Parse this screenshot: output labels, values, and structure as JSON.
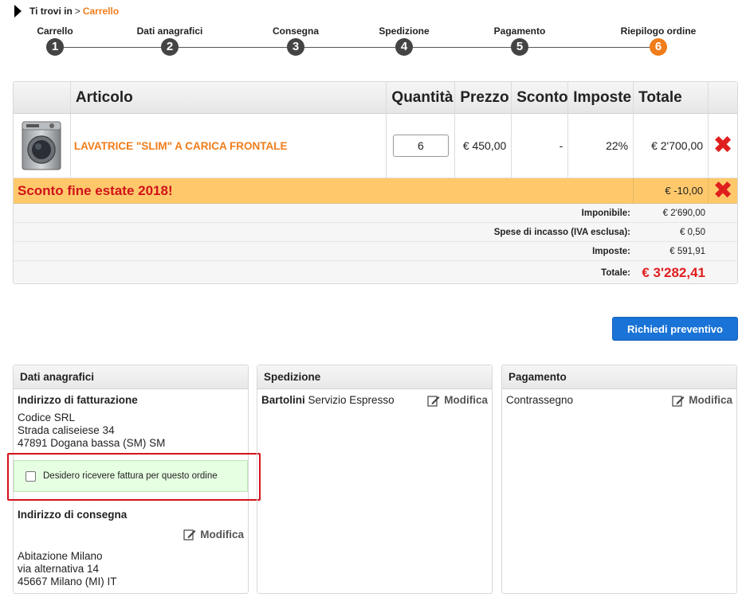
{
  "breadcrumb": {
    "prefix": "Ti trovi in",
    "separator": ">",
    "current": "Carrello"
  },
  "steps": [
    {
      "num": "1",
      "label": "Carrello"
    },
    {
      "num": "2",
      "label": "Dati anagrafici"
    },
    {
      "num": "3",
      "label": "Consegna"
    },
    {
      "num": "4",
      "label": "Spedizione"
    },
    {
      "num": "5",
      "label": "Pagamento"
    },
    {
      "num": "6",
      "label": "Riepilogo ordine"
    }
  ],
  "active_step": "6",
  "cart": {
    "headers": {
      "article": "Articolo",
      "qty": "Quantità",
      "price": "Prezzo",
      "discount": "Sconto",
      "tax": "Imposte",
      "total": "Totale"
    },
    "item": {
      "name": "LAVATRICE \"SLIM\" A CARICA FRONTALE",
      "qty": "6",
      "price": "€ 450,00",
      "discount": "-",
      "tax": "22%",
      "total": "€ 2'700,00"
    },
    "discount_row": {
      "name": "Sconto fine estate 2018!",
      "amount": "€ -10,00"
    },
    "summary": [
      {
        "label": "Imponibile:",
        "value": "€ 2'690,00"
      },
      {
        "label": "Spese di incasso (IVA esclusa):",
        "value": "€ 0,50"
      },
      {
        "label": "Imposte:",
        "value": "€ 591,91"
      }
    ],
    "total": {
      "label": "Totale:",
      "value": "€ 3'282,41"
    }
  },
  "quote_button": "Richiedi preventivo",
  "panels": {
    "personal": {
      "title": "Dati anagrafici",
      "billing_title": "Indirizzo di fatturazione",
      "billing_lines": [
        "Codice SRL",
        "Strada caliseiese 34",
        "47891 Dogana bassa (SM) SM"
      ],
      "invoice_checkbox": "Desidero ricevere fattura per questo ordine",
      "delivery_title": "Indirizzo di consegna",
      "delivery_lines": [
        "Abitazione Milano",
        "via alternativa 14",
        "45667 Milano (MI) IT"
      ]
    },
    "shipping": {
      "title": "Spedizione",
      "carrier": "Bartolini",
      "service": "Servizio Espresso"
    },
    "payment": {
      "title": "Pagamento",
      "method": "Contrassegno"
    },
    "edit_label": "Modifica"
  },
  "colors": {
    "accent": "#f07d1a",
    "total_red": "#e01e1e",
    "button_blue": "#1a73d6",
    "discount_bg": "#ffc96b"
  },
  "icons": {
    "delete": "x-icon",
    "edit": "edit-icon",
    "breadcrumb": "triangle-right-icon"
  }
}
